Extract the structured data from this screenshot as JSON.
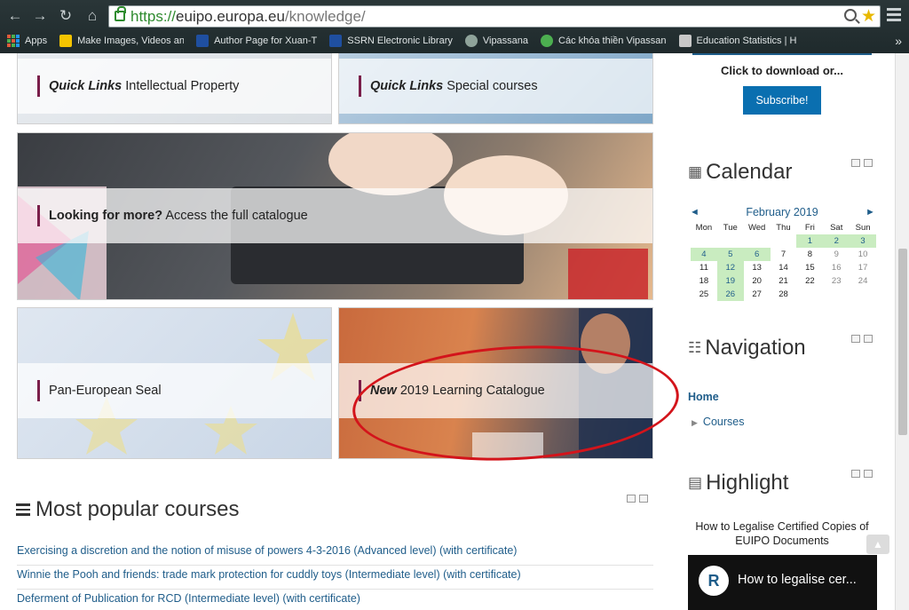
{
  "browser": {
    "url_scheme": "https://",
    "url_host": "euipo.europa.eu",
    "url_path": "/knowledge/",
    "bookmarks": [
      {
        "label": "Apps"
      },
      {
        "label": "Make Images, Videos an"
      },
      {
        "label": "Author Page for Xuan-T"
      },
      {
        "label": "SSRN Electronic Library"
      },
      {
        "label": "Vipassana"
      },
      {
        "label": "Các khóa thiền Vipassan"
      },
      {
        "label": "Education Statistics | H"
      }
    ],
    "more_glyph": "»"
  },
  "tiles": [
    {
      "bold": "Quick Links",
      "rest": " Intellectual Property"
    },
    {
      "bold": "Quick Links",
      "rest": " Special courses"
    },
    {
      "bold": "Looking for more?",
      "rest": " Access the full catalogue"
    },
    {
      "bold": "",
      "rest": "Pan-European Seal"
    },
    {
      "bold": "New",
      "rest": " 2019 Learning Catalogue"
    }
  ],
  "popular": {
    "title": "Most popular courses",
    "courses": [
      "Exercising a discretion and the notion of misuse of powers 4-3-2016 (Advanced level) (with certificate)",
      "Winnie the Pooh and friends: trade mark protection for cuddly toys (Intermediate level) (with certificate)",
      "Deferment of Publication for RCD (Intermediate level) (with certificate)"
    ]
  },
  "sidebar": {
    "click_download": "Click to download or...",
    "subscribe": "Subscribe!",
    "calendar": {
      "title": "Calendar",
      "month": "February 2019",
      "prev": "◄",
      "next": "►",
      "weekdays": [
        "Mon",
        "Tue",
        "Wed",
        "Thu",
        "Fri",
        "Sat",
        "Sun"
      ]
    },
    "navigation": {
      "title": "Navigation",
      "home": "Home",
      "courses": "Courses"
    },
    "highlight": {
      "title": "Highlight",
      "caption": "How to Legalise Certified Copies of EUIPO Documents",
      "video_title": "How to legalise cer...",
      "video_logo": "R"
    }
  }
}
